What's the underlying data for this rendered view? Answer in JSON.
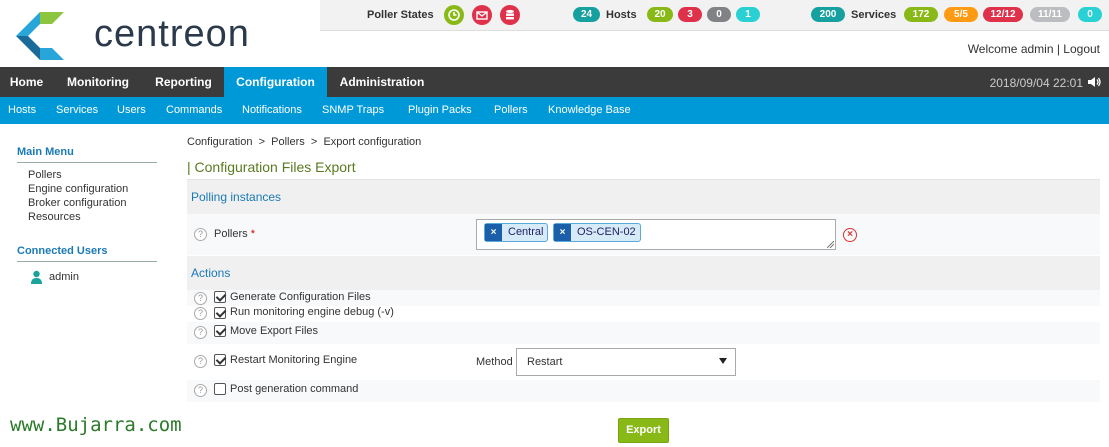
{
  "brand": {
    "name": "centreon",
    "logo_colors": [
      "#29a6d9",
      "#8cc540",
      "#1a6a9a"
    ]
  },
  "status_bar": {
    "poller_label": "Poller States",
    "poller_icons": [
      {
        "icon": "clock-icon",
        "color": "#88b917"
      },
      {
        "icon": "envelope-icon",
        "color": "#e0314b"
      },
      {
        "icon": "database-icon",
        "color": "#e0314b"
      }
    ],
    "hosts_label": "Hosts",
    "hosts_total": "24",
    "hosts_counts": [
      {
        "value": "20",
        "color": "#88b917"
      },
      {
        "value": "3",
        "color": "#e0314b"
      },
      {
        "value": "0",
        "color": "#818285"
      },
      {
        "value": "1",
        "color": "#2ad1d4"
      }
    ],
    "services_label": "Services",
    "services_total": "200",
    "services_counts": [
      {
        "value": "172",
        "color": "#88b917"
      },
      {
        "value": "5/5",
        "color": "#ff9a13"
      },
      {
        "value": "12/12",
        "color": "#e0314b"
      },
      {
        "value": "11/11",
        "color": "#bcbdc0"
      },
      {
        "value": "0",
        "color": "#2ad1d4"
      }
    ],
    "total_color": "#17a0a0"
  },
  "header": {
    "welcome": "Welcome admin",
    "separator": " | ",
    "logout": "Logout"
  },
  "topnav": {
    "items": [
      "Home",
      "Monitoring",
      "Reporting",
      "Configuration",
      "Administration"
    ],
    "active": "Configuration",
    "clock": "2018/09/04 22:01"
  },
  "subnav": {
    "items": [
      "Hosts",
      "Services",
      "Users",
      "Commands",
      "Notifications",
      "SNMP Traps",
      "Plugin Packs",
      "Pollers",
      "Knowledge Base"
    ]
  },
  "sidebar": {
    "main_menu_title": "Main Menu",
    "main_menu_items": [
      "Pollers",
      "Engine configuration",
      "Broker configuration",
      "Resources"
    ],
    "connected_users_title": "Connected Users",
    "connected_users": [
      "admin"
    ]
  },
  "breadcrumb": [
    "Configuration",
    "Pollers",
    "Export configuration"
  ],
  "breadcrumb_sep": ">",
  "page_title": "| Configuration Files Export",
  "polling_section": {
    "title": "Polling instances",
    "pollers_label": "Pollers",
    "required_mark": "*",
    "selected_pollers": [
      "Central",
      "OS-CEN-02"
    ],
    "tag_remove_glyph": "×",
    "clear_glyph": "×"
  },
  "actions_section": {
    "title": "Actions",
    "items": [
      {
        "label": "Generate Configuration Files",
        "checked": true
      },
      {
        "label": "Run monitoring engine debug (-v)",
        "checked": true
      },
      {
        "label": "Move Export Files",
        "checked": true
      },
      {
        "label": "Restart Monitoring Engine",
        "checked": true
      },
      {
        "label": "Post generation command",
        "checked": false
      }
    ],
    "method_label": "Method",
    "method_value": "Restart"
  },
  "help_glyph": "?",
  "export_button": "Export",
  "watermark": "www.Bujarra.com"
}
